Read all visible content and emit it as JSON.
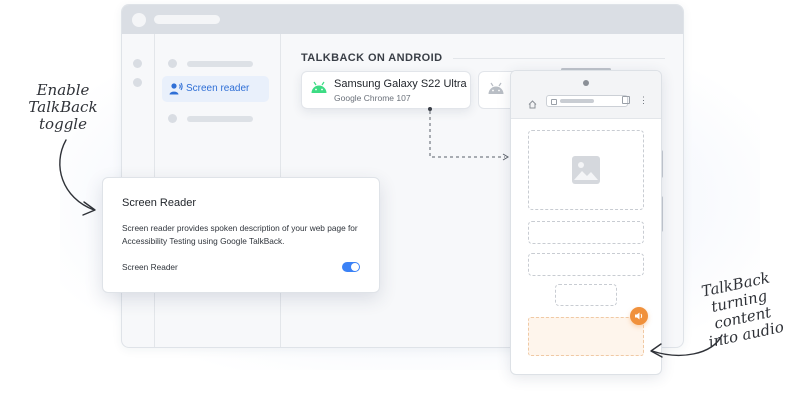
{
  "sidebar": {
    "active_item": {
      "label": "Screen reader",
      "icon": "person-audio-icon"
    }
  },
  "main": {
    "section_title": "TALKBACK ON ANDROID",
    "device": {
      "name": "Samsung Galaxy S22 Ultra",
      "browser": "Google Chrome 107",
      "icon": "android-icon"
    }
  },
  "panel": {
    "title": "Screen Reader",
    "description": "Screen reader provides spoken description of your web page for Accessibility Testing using Google TalkBack.",
    "toggle_label": "Screen Reader",
    "toggle_on": true
  },
  "annotations": {
    "left": [
      "Enable",
      "TalkBack",
      "toggle"
    ],
    "right": [
      "TalkBack",
      "turning content",
      "into audio"
    ]
  },
  "colors": {
    "accent": "#3b82f6",
    "android": "#3ddc84",
    "audio": "#f0913c"
  }
}
